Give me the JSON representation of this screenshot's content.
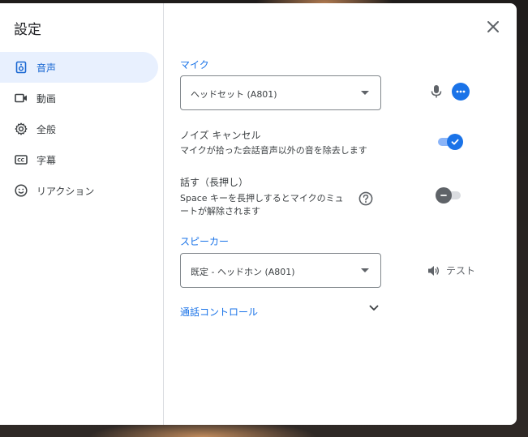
{
  "dialog": {
    "title": "設定",
    "close_icon": "close-icon"
  },
  "sidebar": {
    "items": [
      {
        "label": "音声",
        "icon": "speaker-icon",
        "active": true
      },
      {
        "label": "動画",
        "icon": "video-camera-icon",
        "active": false
      },
      {
        "label": "全般",
        "icon": "gear-icon",
        "active": false
      },
      {
        "label": "字幕",
        "icon": "closed-caption-icon",
        "active": false
      },
      {
        "label": "リアクション",
        "icon": "smiley-icon",
        "active": false
      }
    ]
  },
  "audio": {
    "mic": {
      "label": "マイク",
      "selected": "ヘッドセット (A801)"
    },
    "noise_cancel": {
      "title": "ノイズ キャンセル",
      "description": "マイクが拾った会話音声以外の音を除去します",
      "enabled": true
    },
    "push_to_talk": {
      "title": "話す（長押し）",
      "description_line1": "Space キーを長押しするとマイクのミュ",
      "description_line2": "ートが解除されます",
      "enabled": false
    },
    "speaker": {
      "label": "スピーカー",
      "selected": "既定 - ヘッドホン (A801)",
      "test_label": "テスト"
    },
    "call_controls": {
      "label": "通話コントロール"
    }
  },
  "colors": {
    "accent": "#1a73e8",
    "active_bg": "#e8f0fe"
  }
}
